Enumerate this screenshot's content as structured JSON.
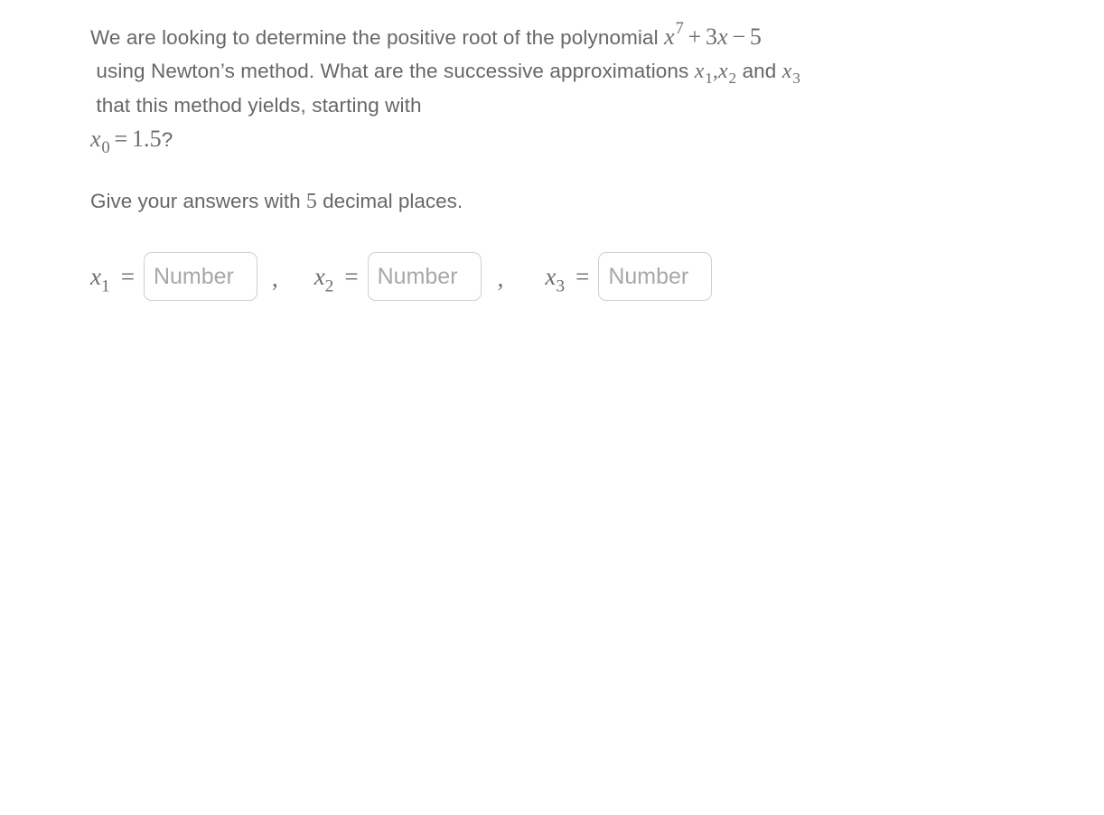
{
  "question": {
    "line1_a": "We are looking to determine the positive root of the polynomial ",
    "polynomial": {
      "base": "x",
      "exponent": "7",
      "rest_op1": "+",
      "coef": "3",
      "var": "x",
      "rest_op2": "−",
      "constant": "5"
    },
    "polynomial_text": "x^7 + 3x - 5",
    "line1_b": " using Newton’s method.",
    "line2_a": "What are the successive approximations ",
    "sym_x1": {
      "base": "x",
      "sub": "1"
    },
    "line2_sep": " , ",
    "sym_x2": {
      "base": "x",
      "sub": "2"
    },
    "line2_b": " and ",
    "sym_x3": {
      "base": "x",
      "sub": "3"
    },
    "line2_c": " that this method yields, starting with",
    "initial_guess": {
      "base": "x",
      "sub": "0",
      "equals": "=",
      "value": "1.5"
    },
    "initial_guess_text": "x_0 = 1.5",
    "question_mark": "?"
  },
  "instruction": {
    "prefix": "Give your answers with ",
    "decimals": "5",
    "suffix": " decimal places."
  },
  "answers": {
    "fields": [
      {
        "label_base": "x",
        "label_sub": "1",
        "equals": "=",
        "value": "",
        "placeholder": "Number",
        "trailing": ","
      },
      {
        "label_base": "x",
        "label_sub": "2",
        "equals": "=",
        "value": "",
        "placeholder": "Number",
        "trailing": ","
      },
      {
        "label_base": "x",
        "label_sub": "3",
        "equals": "=",
        "value": "",
        "placeholder": "Number",
        "trailing": ""
      }
    ]
  },
  "colors": {
    "background": "#ffffff",
    "text": "#676767",
    "math": "#6e6e6e",
    "input_border": "#cfcfcf",
    "placeholder": "#a8a8a8"
  }
}
